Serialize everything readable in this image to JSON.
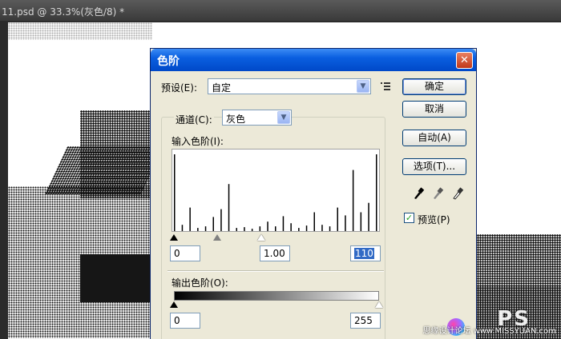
{
  "document": {
    "title": "11.psd @ 33.3%(灰色/8) *"
  },
  "dialog": {
    "title": "色阶",
    "close_icon": "close-icon",
    "preset_label": "预设(E):",
    "preset_value": "自定",
    "preset_options_icon": "menu-list-icon",
    "channel_label": "通道(C):",
    "channel_value": "灰色",
    "input_levels_label": "输入色阶(I):",
    "input_black": "0",
    "input_gamma": "1.00",
    "input_white": "110",
    "output_levels_label": "输出色阶(O):",
    "output_black": "0",
    "output_white": "255",
    "buttons": {
      "ok": "确定",
      "cancel": "取消",
      "auto": "自动(A)",
      "options": "选项(T)..."
    },
    "eyedroppers": [
      "black-eyedropper-icon",
      "gray-eyedropper-icon",
      "white-eyedropper-icon"
    ],
    "preview_label": "预览(P)",
    "preview_checked": true,
    "histogram_heights": [
      0.98,
      0.08,
      0.3,
      0.04,
      0.06,
      0.18,
      0.28,
      0.6,
      0.04,
      0.05,
      0.03,
      0.06,
      0.12,
      0.06,
      0.19,
      0.1,
      0.04,
      0.07,
      0.24,
      0.08,
      0.06,
      0.3,
      0.2,
      0.78,
      0.24,
      0.36,
      0.98
    ]
  },
  "watermark": {
    "brand": "PS",
    "text": "思缘设计论坛 www.MISSYUAN.com"
  }
}
